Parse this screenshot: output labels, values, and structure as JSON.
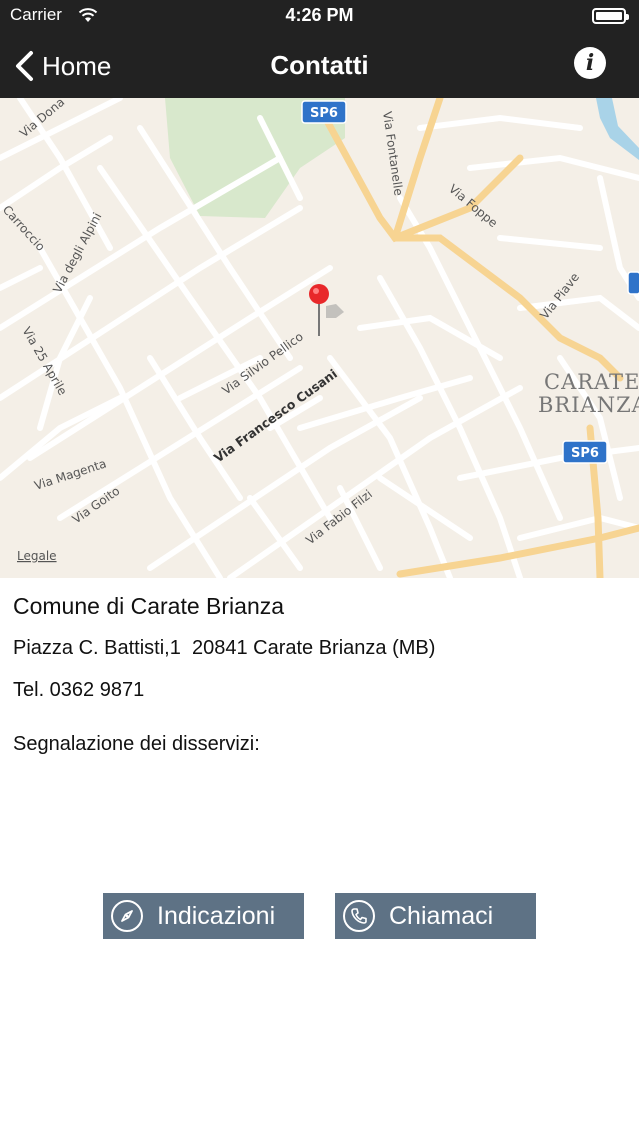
{
  "status_bar": {
    "carrier": "Carrier",
    "time": "4:26 PM"
  },
  "nav": {
    "back_label": "Home",
    "title": "Contatti"
  },
  "map": {
    "legal_label": "Legale",
    "streets": [
      "Via Francesco Cusani",
      "Via Silvio Pellico",
      "Via degli Alpini",
      "Via 25 Aprile",
      "Via Magenta",
      "Via Goito",
      "Via Fabio Filzi",
      "Via Piave",
      "Via Foppe",
      "Via Fontanelle",
      "Carroccio",
      "Via Dona"
    ],
    "road_badges": [
      "SP6",
      "SP6"
    ],
    "town_lines": [
      "CARATE",
      "BRIANZA"
    ]
  },
  "contact": {
    "name": "Comune di Carate Brianza",
    "address": "Piazza C. Battisti,1  20841 Carate Brianza (MB)",
    "phone": "Tel. 0362 9871",
    "report_label": "Segnalazione dei disservizi:"
  },
  "buttons": {
    "directions": "Indicazioni",
    "call": "Chiamaci"
  },
  "colors": {
    "nav_bg": "#222222",
    "button_bg": "#5e7285",
    "pin": "#e8282a"
  }
}
